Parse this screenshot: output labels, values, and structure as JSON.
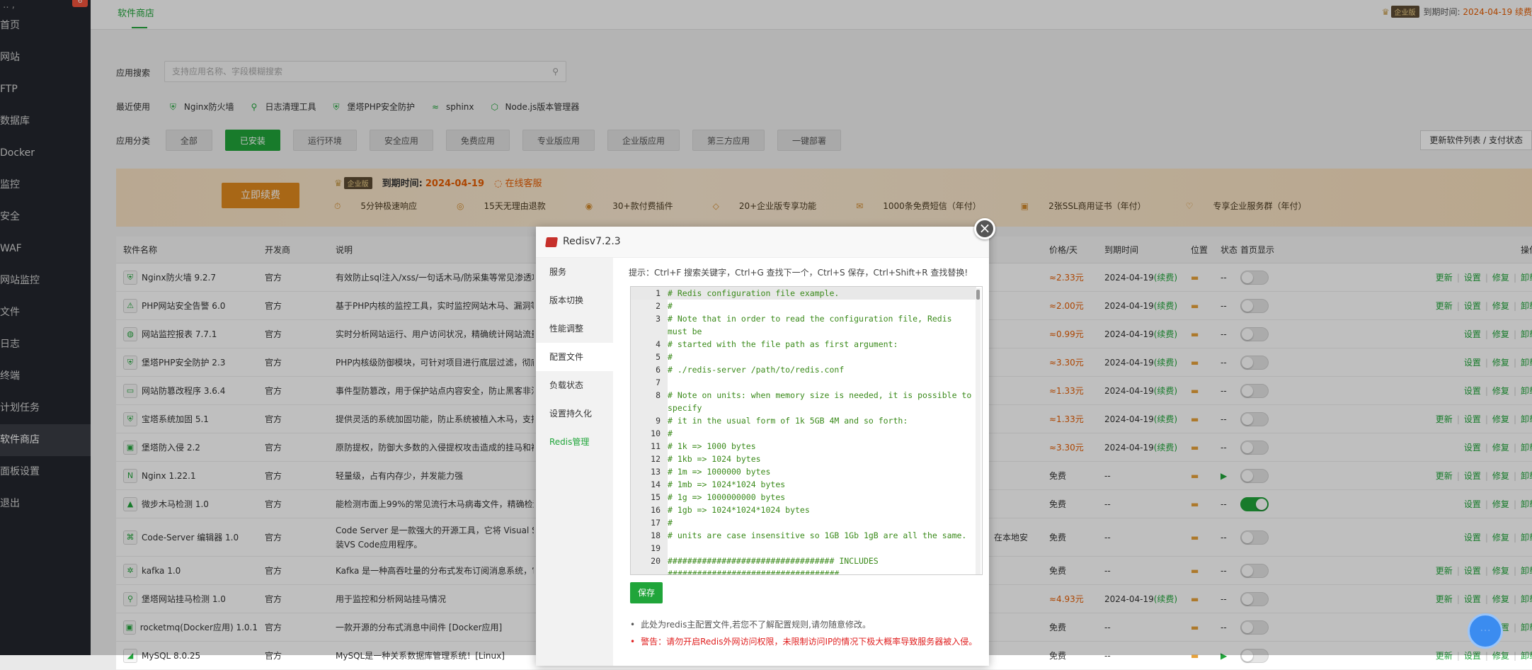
{
  "sidebar": {
    "logo": "‥ ,",
    "badge": "6",
    "items": [
      "首页",
      "网站",
      "FTP",
      "数据库",
      "Docker",
      "监控",
      "安全",
      "WAF",
      "网站监控",
      "文件",
      "日志",
      "终端",
      "计划任务",
      "软件商店",
      "面板设置",
      "退出"
    ],
    "active_index": 13
  },
  "topbar": {
    "tab": "软件商店",
    "enterprise_badge": "企业版",
    "expire_label": "到期时间:",
    "expire_date": "2024-04-19",
    "renew": "续费"
  },
  "search": {
    "label": "应用搜索",
    "placeholder": "支持应用名称、字段模糊搜索"
  },
  "recent": {
    "label": "最近使用",
    "items": [
      "Nginx防火墙",
      "日志清理工具",
      "堡塔PHP安全防护",
      "sphinx",
      "Node.js版本管理器"
    ]
  },
  "categories": {
    "label": "应用分类",
    "items": [
      "全部",
      "已安装",
      "运行环境",
      "安全应用",
      "免费应用",
      "专业版应用",
      "企业版应用",
      "第三方应用",
      "一键部署"
    ],
    "active_index": 1,
    "update_button": "更新软件列表 / 支付状态"
  },
  "banner": {
    "renew_button": "立即续费",
    "badge": "企业版",
    "expire_label": "到期时间:",
    "expire_date": "2024-04-19",
    "service": "在线客服",
    "features": [
      "5分钟极速响应",
      "15天无理由退款",
      "30+款付费插件",
      "20+企业版专享功能",
      "1000条免费短信（年付）",
      "2张SSL商用证书（年付）",
      "专享企业服务群（年付）"
    ]
  },
  "table": {
    "headers": {
      "name": "软件名称",
      "dev": "开发商",
      "desc": "说明",
      "price": "价格/天",
      "expire": "到期时间",
      "pos": "位置",
      "status": "状态",
      "home": "首页显示",
      "ops": "操作"
    },
    "rows": [
      {
        "name": "Nginx防火墙 9.2.7",
        "dev": "官方",
        "desc": "有效防止sql注入/xss/一句话木马/防采集等常见渗透攻",
        "price": "≈2.33元",
        "exp": "2024-04-19",
        "renew": "(续费)",
        "status": "--",
        "play": false,
        "on": false,
        "ops": [
          "更新",
          "设置",
          "修复",
          "卸载"
        ]
      },
      {
        "name": "PHP网站安全告警 6.0",
        "dev": "官方",
        "desc": "基于PHP内核的监控工具，实时监控网站木马、漏洞等",
        "price": "≈2.00元",
        "exp": "2024-04-19",
        "renew": "(续费)",
        "status": "--",
        "play": false,
        "on": false,
        "ops": [
          "更新",
          "设置",
          "修复",
          "卸载"
        ]
      },
      {
        "name": "网站监控报表 7.7.1",
        "dev": "官方",
        "desc": "实时分析网站运行、用户访问状况，精确统计网站流量",
        "price": "≈0.99元",
        "exp": "2024-04-19",
        "renew": "(续费)",
        "status": "--",
        "play": false,
        "on": false,
        "ops": [
          "设置",
          "修复",
          "卸载"
        ]
      },
      {
        "name": "堡塔PHP安全防护 2.3",
        "dev": "官方",
        "desc": "PHP内核级防御模块，可针对项目进行底层过滤，彻底",
        "price": "≈3.30元",
        "exp": "2024-04-19",
        "renew": "(续费)",
        "status": "--",
        "play": false,
        "on": false,
        "ops": [
          "设置",
          "修复",
          "卸载"
        ]
      },
      {
        "name": "网站防篡改程序 3.6.4",
        "dev": "官方",
        "desc": "事件型防篡改，用于保护站点内容安全，防止黑客非法",
        "price": "≈1.33元",
        "exp": "2024-04-19",
        "renew": "(续费)",
        "status": "--",
        "play": false,
        "on": false,
        "ops": [
          "设置",
          "修复",
          "卸载"
        ]
      },
      {
        "name": "宝塔系统加固 5.1",
        "dev": "官方",
        "desc": "提供灵活的系统加固功能，防止系统被植入木马，支持",
        "price": "≈1.33元",
        "exp": "2024-04-19",
        "renew": "(续费)",
        "status": "--",
        "play": false,
        "on": false,
        "ops": [
          "更新",
          "设置",
          "修复",
          "卸载"
        ]
      },
      {
        "name": "堡塔防入侵 2.2",
        "dev": "官方",
        "desc": "原防提权，防御大多数的入侵提权攻击造成的挂马和被",
        "price": "≈3.30元",
        "exp": "2024-04-19",
        "renew": "(续费)",
        "status": "--",
        "play": false,
        "on": false,
        "ops": [
          "设置",
          "修复",
          "卸载"
        ]
      },
      {
        "name": "Nginx 1.22.1",
        "dev": "官方",
        "desc": "轻量级，占有内存少，并发能力强",
        "price": "免费",
        "exp": "--",
        "renew": "",
        "status": "",
        "play": true,
        "on": false,
        "ops": [
          "更新",
          "设置",
          "修复",
          "卸载"
        ]
      },
      {
        "name": "微步木马检测 1.0",
        "dev": "官方",
        "desc": "能检测市面上99%的常见流行木马病毒文件，精确检测",
        "price": "免费",
        "exp": "--",
        "renew": "",
        "status": "--",
        "play": false,
        "on": true,
        "ops": [
          "设置",
          "修复",
          "卸载"
        ]
      },
      {
        "name": "Code-Server 编辑器 1.0",
        "dev": "官方",
        "desc": "Code Server 是一款强大的开源工具，它将 Visual Stu",
        "desc2": "装VS Code应用程序。",
        "mid": "在本地安",
        "price": "免费",
        "exp": "--",
        "renew": "",
        "status": "--",
        "play": false,
        "on": false,
        "ops": [
          "设置",
          "修复",
          "卸载"
        ],
        "tall": true
      },
      {
        "name": "kafka 1.0",
        "dev": "官方",
        "desc": "Kafka 是一种高吞吐量的分布式发布订阅消息系统，它",
        "price": "免费",
        "exp": "--",
        "renew": "",
        "status": "--",
        "play": false,
        "on": false,
        "ops": [
          "更新",
          "设置",
          "修复",
          "卸载"
        ]
      },
      {
        "name": "堡塔网站挂马检测 1.0",
        "dev": "官方",
        "desc": "用于监控和分析网站挂马情况",
        "price": "≈4.93元",
        "exp": "2024-04-19",
        "renew": "(续费)",
        "status": "--",
        "play": false,
        "on": false,
        "ops": [
          "更新",
          "设置",
          "修复",
          "卸载"
        ]
      },
      {
        "name": "rocketmq(Docker应用) 1.0.1",
        "dev": "官方",
        "desc": "一款开源的分布式消息中间件 [Docker应用]",
        "price": "免费",
        "exp": "--",
        "renew": "",
        "status": "--",
        "play": false,
        "on": false,
        "ops": [
          "设置",
          "卸载"
        ]
      },
      {
        "name": "MySQL 8.0.25",
        "dev": "官方",
        "desc": "MySQL是一种关系数据库管理系统！[Linux]",
        "price": "免费",
        "exp": "--",
        "renew": "",
        "status": "",
        "play": true,
        "on": false,
        "ops": [
          "更新",
          "设置",
          "修复",
          "卸载"
        ]
      }
    ]
  },
  "modal": {
    "title": "Redisv7.2.3",
    "menu": [
      "服务",
      "版本切换",
      "性能调整",
      "配置文件",
      "负载状态",
      "设置持久化",
      "Redis管理"
    ],
    "active_index": 3,
    "tip": "提示：Ctrl+F 搜索关键字，Ctrl+G 查找下一个，Ctrl+S 保存，Ctrl+Shift+R 查找替换!",
    "code_lines": [
      "# Redis configuration file example.",
      "#",
      "# Note that in order to read the configuration file, Redis must be",
      "# started with the file path as first argument:",
      "#",
      "# ./redis-server /path/to/redis.conf",
      "",
      "# Note on units: when memory size is needed, it is possible to specify",
      "# it in the usual form of 1k 5GB 4M and so forth:",
      "#",
      "# 1k => 1000 bytes",
      "# 1kb => 1024 bytes",
      "# 1m => 1000000 bytes",
      "# 1mb => 1024*1024 bytes",
      "# 1g => 1000000000 bytes",
      "# 1gb => 1024*1024*1024 bytes",
      "#",
      "# units are case insensitive so 1GB 1Gb 1gB are all the same.",
      "",
      "################################## INCLUDES ###################################"
    ],
    "save": "保存",
    "note1": "此处为redis主配置文件,若您不了解配置规则,请勿随意修改。",
    "note2": "警告：请勿开启Redis外网访问权限，未限制访问IP的情况下极大概率导致服务器被入侵。",
    "close": "×"
  },
  "colors": {
    "accent": "#20a53a",
    "warn": "#e65c00",
    "sidebar_bg": "#23262e"
  }
}
